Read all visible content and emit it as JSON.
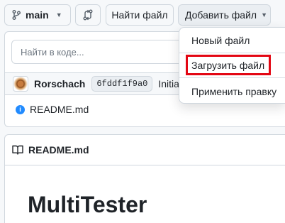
{
  "toolbar": {
    "branch": "main",
    "find_file": "Найти файл",
    "add_file": "Добавить файл"
  },
  "search": {
    "placeholder": "Найти в коде..."
  },
  "commit": {
    "author": "Rorschach",
    "sha": "6fddf1f9a0",
    "message": "Initial c"
  },
  "files": [
    {
      "name": "README.md"
    }
  ],
  "readme": {
    "header": "README.md",
    "title": "MultiTester"
  },
  "dropdown": {
    "items": [
      {
        "label": "Новый файл"
      },
      {
        "label": "Загрузить файл"
      },
      {
        "label": "Применить правку"
      }
    ],
    "highlight_color": "#e30613"
  },
  "colors": {
    "accent": "#218bff"
  }
}
